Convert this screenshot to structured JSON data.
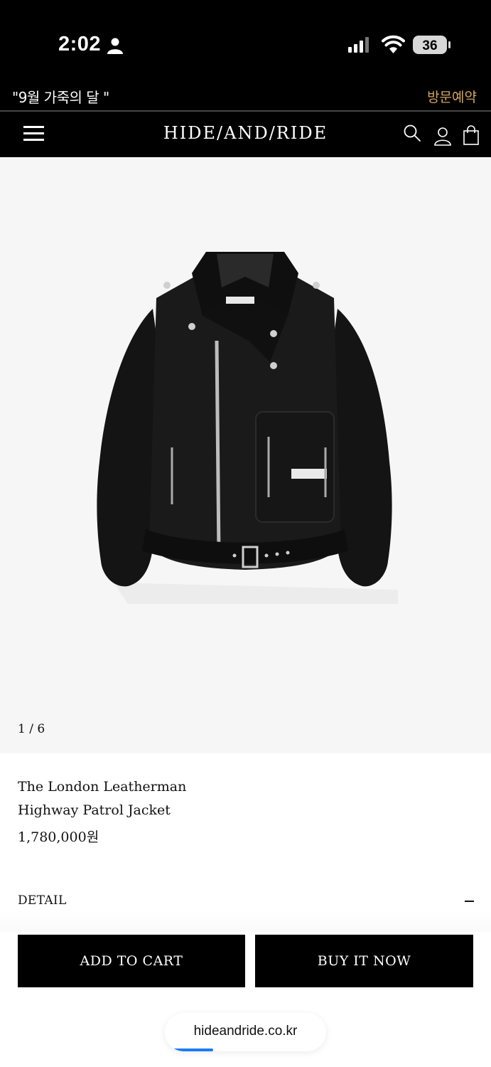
{
  "status_bar": {
    "time": "2:02",
    "battery": "36"
  },
  "announcement": {
    "text": "\"9월 가죽의 달 \"",
    "link": "방문예약"
  },
  "header": {
    "logo": "HIDE/AND/RIDE"
  },
  "gallery": {
    "counter": "1 / 6"
  },
  "product": {
    "name_line1": "The London Leatherman",
    "name_line2": "Highway Patrol Jacket",
    "price": "1,780,000원"
  },
  "detail": {
    "label": "DETAIL",
    "toggle": "collapse"
  },
  "actions": {
    "add_to_cart": "ADD TO CART",
    "buy_now": "BUY IT NOW"
  },
  "browser": {
    "url": "hideandride.co.kr",
    "load_progress": 0.3
  },
  "icons": {
    "menu": "menu-icon",
    "search": "search-icon",
    "account": "user-icon",
    "cart": "shopping-bag-icon"
  },
  "colors": {
    "header_bg": "#000000",
    "accent_link": "#d3a55e",
    "button_bg": "#000000",
    "gallery_bg": "#f6f6f6"
  }
}
